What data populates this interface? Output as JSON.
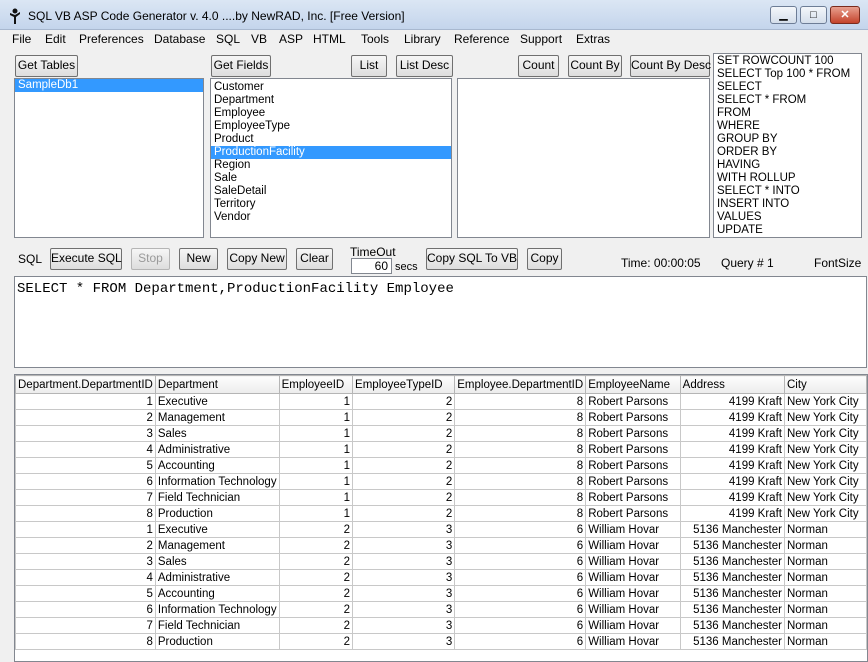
{
  "window": {
    "title": "SQL VB ASP Code Generator  v. 4.0      ....by NewRAD, Inc.          [Free Version]",
    "minimize": "▁",
    "maximize": "□",
    "close": "✕"
  },
  "menu": [
    "File",
    "Edit",
    "Preferences",
    "Database",
    "SQL",
    "VB",
    "ASP",
    "HTML",
    "Tools",
    "Library",
    "Reference",
    "Support",
    "Extras"
  ],
  "toolbar": {
    "get_tables": "Get Tables",
    "get_fields": "Get Fields",
    "list": "List",
    "list_desc": "List Desc",
    "count": "Count",
    "count_by": "Count By",
    "count_by_desc": "Count By Desc"
  },
  "tables_list": {
    "items": [
      "SampleDb1"
    ],
    "selected": "SampleDb1"
  },
  "fields_list": {
    "items": [
      "Customer",
      "Department",
      "Employee",
      "EmployeeType",
      "Product",
      "ProductionFacility",
      "Region",
      "Sale",
      "SaleDetail",
      "Territory",
      "Vendor"
    ],
    "selected": "ProductionFacility"
  },
  "keywords_list": [
    "SET ROWCOUNT 100",
    "SELECT Top 100 * FROM",
    "SELECT",
    "SELECT * FROM",
    "FROM",
    "WHERE",
    "GROUP BY",
    "ORDER BY",
    "HAVING",
    "WITH ROLLUP",
    "SELECT * INTO",
    "INSERT INTO",
    "VALUES",
    "UPDATE"
  ],
  "sql_bar": {
    "label": "SQL",
    "execute": "Execute SQL",
    "stop": "Stop",
    "new": "New",
    "copy_new": "Copy New",
    "clear": "Clear",
    "timeout_label": "TimeOut",
    "timeout_value": "60",
    "timeout_unit": "secs",
    "copy_sql_to_vb": "Copy SQL To VB",
    "copy": "Copy",
    "time": "Time:  00:00:05",
    "query": "Query #  1",
    "font_size": "FontSize"
  },
  "sql_text": "SELECT * FROM Department,ProductionFacility Employee",
  "grid": {
    "columns": [
      "Department.DepartmentID",
      "Department",
      "EmployeeID",
      "EmployeeTypeID",
      "Employee.DepartmentID",
      "EmployeeName",
      "Address",
      "City"
    ],
    "rows": [
      [
        "1",
        "Executive",
        "1",
        "2",
        "8",
        "Robert Parsons",
        "4199 Kraft",
        "New York City"
      ],
      [
        "2",
        "Management",
        "1",
        "2",
        "8",
        "Robert Parsons",
        "4199 Kraft",
        "New York City"
      ],
      [
        "3",
        "Sales",
        "1",
        "2",
        "8",
        "Robert Parsons",
        "4199 Kraft",
        "New York City"
      ],
      [
        "4",
        "Administrative",
        "1",
        "2",
        "8",
        "Robert Parsons",
        "4199 Kraft",
        "New York City"
      ],
      [
        "5",
        "Accounting",
        "1",
        "2",
        "8",
        "Robert Parsons",
        "4199 Kraft",
        "New York City"
      ],
      [
        "6",
        "Information Technology",
        "1",
        "2",
        "8",
        "Robert Parsons",
        "4199 Kraft",
        "New York City"
      ],
      [
        "7",
        "Field Technician",
        "1",
        "2",
        "8",
        "Robert Parsons",
        "4199 Kraft",
        "New York City"
      ],
      [
        "8",
        "Production",
        "1",
        "2",
        "8",
        "Robert Parsons",
        "4199 Kraft",
        "New York City"
      ],
      [
        "1",
        "Executive",
        "2",
        "3",
        "6",
        "William Hovar",
        "5136 Manchester",
        "Norman"
      ],
      [
        "2",
        "Management",
        "2",
        "3",
        "6",
        "William Hovar",
        "5136 Manchester",
        "Norman"
      ],
      [
        "3",
        "Sales",
        "2",
        "3",
        "6",
        "William Hovar",
        "5136 Manchester",
        "Norman"
      ],
      [
        "4",
        "Administrative",
        "2",
        "3",
        "6",
        "William Hovar",
        "5136 Manchester",
        "Norman"
      ],
      [
        "5",
        "Accounting",
        "2",
        "3",
        "6",
        "William Hovar",
        "5136 Manchester",
        "Norman"
      ],
      [
        "6",
        "Information Technology",
        "2",
        "3",
        "6",
        "William Hovar",
        "5136 Manchester",
        "Norman"
      ],
      [
        "7",
        "Field Technician",
        "2",
        "3",
        "6",
        "William Hovar",
        "5136 Manchester",
        "Norman"
      ],
      [
        "8",
        "Production",
        "2",
        "3",
        "6",
        "William Hovar",
        "5136 Manchester",
        "Norman"
      ]
    ]
  },
  "colors": {
    "selection": "#3399ff",
    "titlebar": "#c4d5ec"
  }
}
